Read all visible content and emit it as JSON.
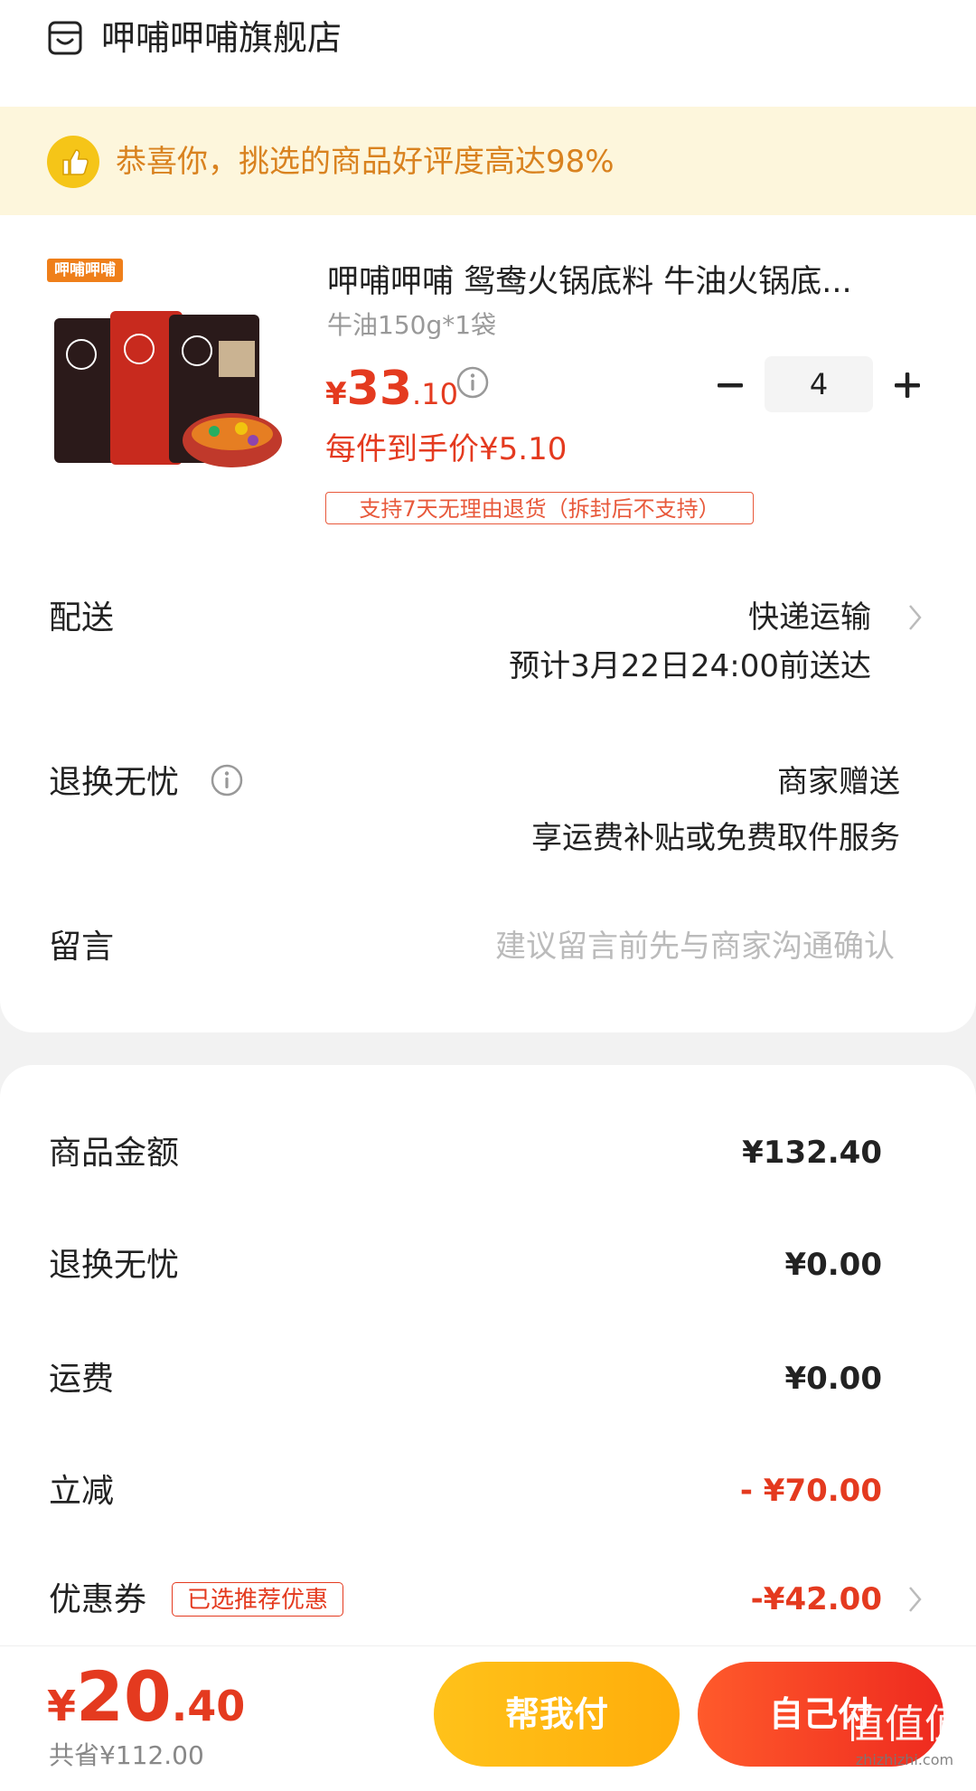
{
  "store": {
    "name": "呷哺呷哺旗舰店",
    "icon": "store-icon"
  },
  "banner": {
    "text": "恭喜你，挑选的商品好评度高达98%",
    "icon": "thumbs-up-icon"
  },
  "product": {
    "brand_badge": "呷哺呷哺",
    "title": "呷哺呷哺 鸳鸯火锅底料 牛油火锅底...",
    "spec": "牛油150g*1袋",
    "price_currency": "¥",
    "price_integer": "33",
    "price_decimal": ".10",
    "quantity": "4",
    "unit_price": "每件到手价¥5.10",
    "return_tag": "支持7天无理由退货（拆封后不支持）"
  },
  "delivery": {
    "label": "配送",
    "method": "快递运输",
    "estimate": "预计3月22日24:00前送达"
  },
  "return_service": {
    "label": "退换无忧",
    "value": "商家赠送",
    "desc": "享运费补贴或免费取件服务"
  },
  "message": {
    "label": "留言",
    "placeholder": "建议留言前先与商家沟通确认"
  },
  "summary": {
    "goods_amount_label": "商品金额",
    "goods_amount": "¥132.40",
    "return_label": "退换无忧",
    "return_amount": "¥0.00",
    "shipping_label": "运费",
    "shipping_amount": "¥0.00",
    "discount_label": "立减",
    "discount_amount": "- ¥70.00",
    "coupon_label": "优惠券",
    "coupon_tag": "已选推荐优惠",
    "coupon_amount": "-¥42.00"
  },
  "footer": {
    "total_currency": "¥",
    "total_integer": "20",
    "total_decimal": ".40",
    "saved": "共省¥112.00",
    "help_pay_button": "帮我付",
    "self_pay_button": "自己付"
  },
  "watermark": {
    "text": "值值值",
    "url": "zhizhizhi.com"
  },
  "colors": {
    "accent_red": "#e43a1f",
    "banner_bg": "#fdf6dc",
    "banner_text": "#d9821f",
    "help_button": "#ffb812"
  }
}
